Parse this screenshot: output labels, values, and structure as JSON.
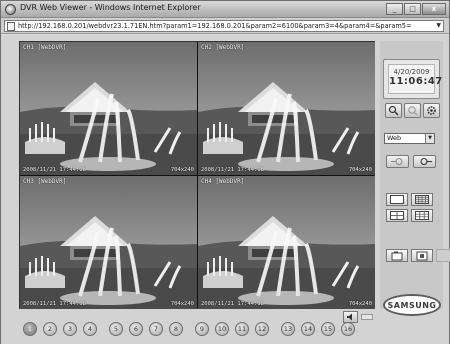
{
  "window": {
    "title": "DVR Web Viewer - Windows Internet Explorer",
    "controls": [
      "_",
      "□",
      "x"
    ]
  },
  "address": {
    "url": "http://192.168.0.201/webdvr23.1.71EN.htm?param1=192.168.0.201&param2=6100&param3=4&param4=&param5="
  },
  "cameras": [
    {
      "label": "CH1 [WebDVR]",
      "timestamp": "2008/11/21 17:44:18",
      "resolution": "704x240"
    },
    {
      "label": "CH2 [WebDVR]",
      "timestamp": "2008/11/21 17:44:18",
      "resolution": "704x240"
    },
    {
      "label": "CH3 [WebDVR]",
      "timestamp": "2008/11/21 17:44:18",
      "resolution": "704x240"
    },
    {
      "label": "CH4 [WebDVR]",
      "timestamp": "2008/11/21 17:44:18",
      "resolution": "704x240"
    }
  ],
  "clock": {
    "date": "4/20/2009",
    "time": "11:06:47"
  },
  "select": {
    "value": "Web"
  },
  "logo": {
    "text": "SAMSUNG"
  },
  "channels": [
    "1",
    "2",
    "3",
    "4",
    "5",
    "6",
    "7",
    "8",
    "9",
    "10",
    "11",
    "12",
    "13",
    "14",
    "15",
    "16"
  ],
  "icons": {
    "toolbar": [
      "search-icon",
      "zoom-icon",
      "gear-icon"
    ],
    "ptz": [
      "ptz-left-icon",
      "ptz-right-icon"
    ],
    "layouts": [
      "single-view-icon",
      "sixteen-view-icon",
      "quad-view-icon",
      "nine-view-icon"
    ],
    "extra": [
      "capture-icon",
      "record-icon",
      "blank-icon"
    ],
    "audio": "speaker-icon"
  },
  "colors": {
    "window_frame": "#6e6e6e",
    "panel": "#c8c8c8",
    "content_bg": "#d3d3d3"
  }
}
